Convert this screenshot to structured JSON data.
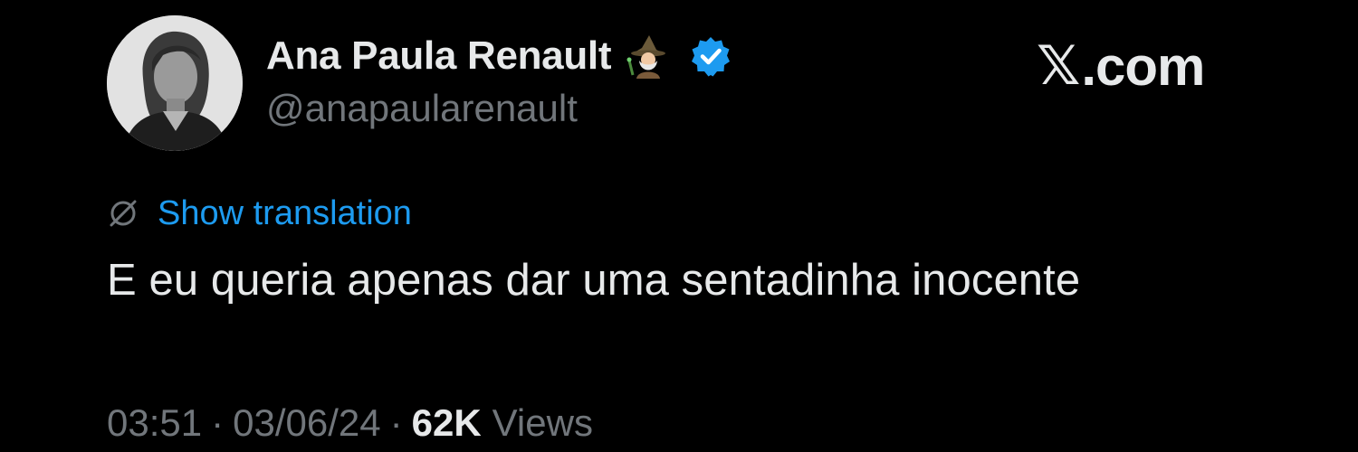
{
  "tweet": {
    "author": {
      "display_name": "Ana Paula Renault",
      "handle": "@anapaularenault",
      "verified": true,
      "emoji": "wizard-emoji"
    },
    "brand": {
      "x_glyph": "𝕏",
      "suffix": ".com"
    },
    "translation_label": "Show translation",
    "text": "E eu queria apenas dar uma sentadinha inocente",
    "meta": {
      "time": "03:51",
      "date": "03/06/24",
      "separator": "·",
      "views_count": "62K",
      "views_label": "Views"
    }
  },
  "colors": {
    "background": "#000000",
    "primary_text": "#e7e9ea",
    "secondary_text": "#71767b",
    "link": "#1d9bf0",
    "verified_badge": "#1d9bf0"
  },
  "icons": {
    "translate": "globe-slash-icon",
    "verified": "verified-check-icon"
  }
}
